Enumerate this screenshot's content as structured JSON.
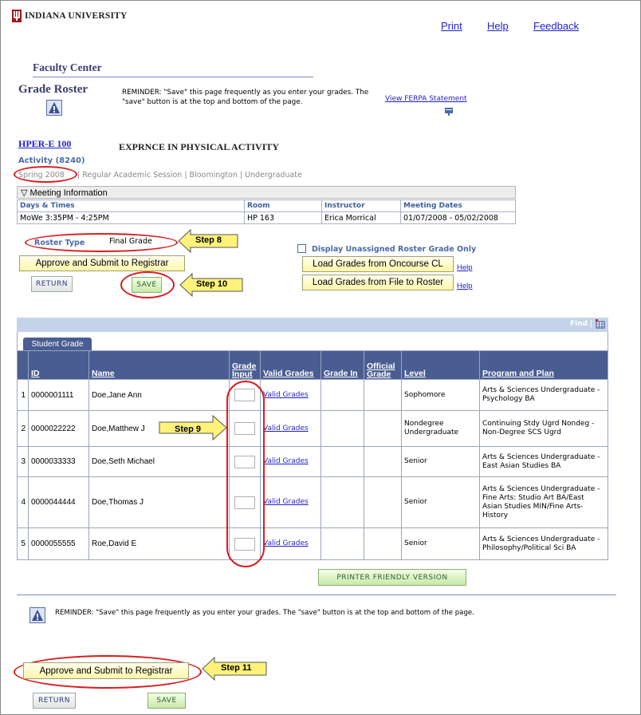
{
  "header": {
    "university": "INDIANA UNIVERSITY",
    "links": {
      "print": "Print",
      "help": "Help",
      "feedback": "Feedback"
    }
  },
  "page": {
    "center_title": "Faculty Center",
    "title": "Grade Roster",
    "reminder": "REMINDER: \"Save\" this page frequently as you enter your grades. The \"save\" button is at the top and bottom of the page.",
    "ferpa_link": "View FERPA Statement"
  },
  "course": {
    "code": "HPER-E 100",
    "name": "EXPRNCE IN PHYSICAL ACTIVITY",
    "activity": "Activity (8240)",
    "term": "Spring 2008",
    "term_rest": "| Regular Academic Session | Bloomington | Undergraduate"
  },
  "meeting": {
    "toggle_label": "Meeting Information",
    "headers": [
      "Days & Times",
      "Room",
      "Instructor",
      "Meeting Dates"
    ],
    "row": [
      "MoWe 3:35PM - 4:25PM",
      "HP 163",
      "Erica Morrical",
      "01/07/2008 - 05/02/2008"
    ]
  },
  "roster": {
    "type_label": "Roster Type",
    "type_value": "Final Grade",
    "unassigned_checkbox": "Display Unassigned Roster Grade Only",
    "approve_button": "Approve and Submit to Registrar",
    "return_button": "RETURN",
    "save_button": "SAVE",
    "load_oncourse_button": "Load Grades from Oncourse CL",
    "load_file_button": "Load Grades from File to Roster",
    "help_link": "Help"
  },
  "steps": {
    "step8": "Step 8",
    "step9": "Step 9",
    "step10": "Step 10",
    "step11": "Step 11"
  },
  "grid": {
    "find_label": "Find",
    "tab_label": "Student Grade",
    "headers": {
      "id": "ID",
      "name": "Name",
      "grade_input": "Grade Input",
      "valid_grades": "Valid Grades",
      "grade_in": "Grade In",
      "official_grade": "Official Grade",
      "level": "Level",
      "program": "Program and Plan"
    },
    "rows": [
      {
        "num": "1",
        "id": "0000001111",
        "name": "Doe,Jane Ann",
        "valid": "Valid Grades",
        "level": "Sophomore",
        "program": "Arts & Sciences Undergraduate - Psychology BA"
      },
      {
        "num": "2",
        "id": "0000022222",
        "name": "Doe,Matthew J",
        "valid": "Valid Grades",
        "level": "Nondegree Undergraduate",
        "program": "Continuing Stdy Ugrd Nondeg - Non-Degree SCS Ugrd"
      },
      {
        "num": "3",
        "id": "0000033333",
        "name": "Doe,Seth Michael",
        "valid": "Valid Grades",
        "level": "Senior",
        "program": "Arts & Sciences Undergraduate - East Asian Studies BA"
      },
      {
        "num": "4",
        "id": "0000044444",
        "name": "Doe,Thomas J",
        "valid": "Valid Grades",
        "level": "Senior",
        "program": "Arts & Sciences Undergraduate - Fine Arts: Studio Art BA/East Asian Studies MIN/Fine Arts-History"
      },
      {
        "num": "5",
        "id": "0000055555",
        "name": "Roe,David E",
        "valid": "Valid Grades",
        "level": "Senior",
        "program": "Arts & Sciences Undergraduate - Philosophy/Political Sci BA"
      }
    ],
    "printer_button": "PRINTER FRIENDLY VERSION"
  },
  "footer": {
    "reminder": "REMINDER: \"Save\" this page frequently as you enter your grades. The \"save\" button is at the top and bottom of the page.",
    "approve_button": "Approve and Submit to Registrar",
    "return_button": "RETURN",
    "save_button": "SAVE"
  },
  "colors": {
    "grid_header": "#4a5d92",
    "callout_yellow": "#fff27a",
    "annotation_red": "#d81e1e",
    "link": "#1f1fc8"
  }
}
